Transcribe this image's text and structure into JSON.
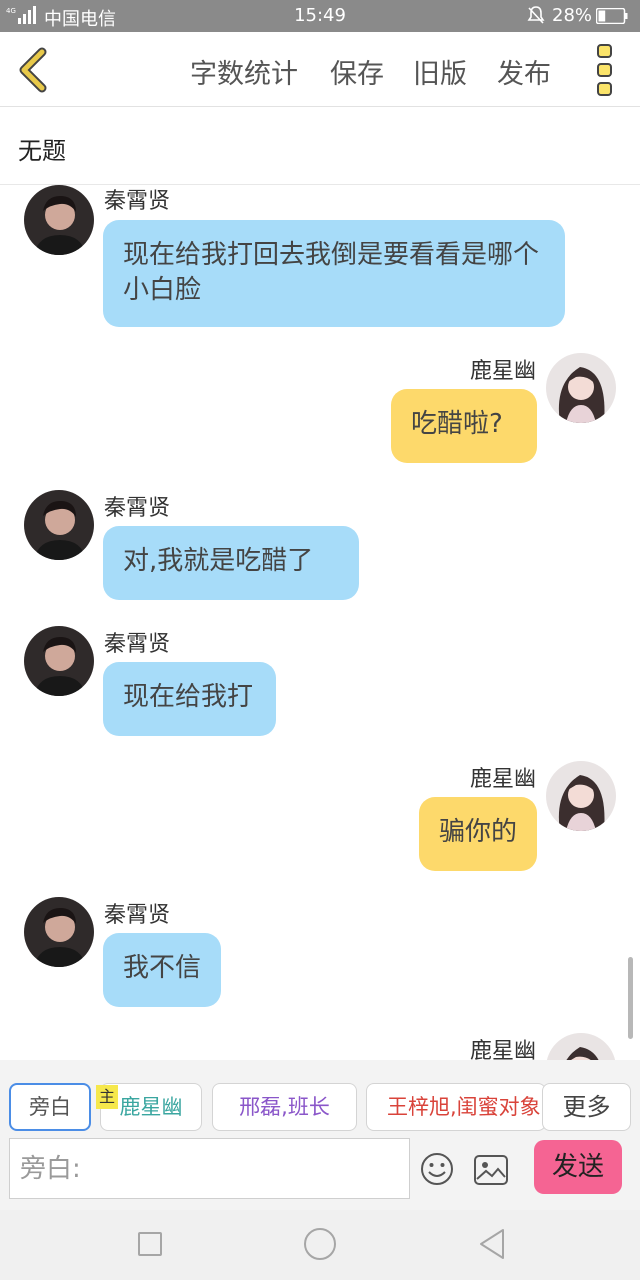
{
  "status_bar": {
    "network": "4G",
    "carrier": "中国电信",
    "time": "15:49",
    "battery": "28%",
    "battery_level": 0.28
  },
  "header": {
    "back_icon": "chevron-left-icon",
    "menu": [
      "字数统计",
      "保存",
      "旧版",
      "发布"
    ],
    "more_icon": "vertical-dots-icon",
    "accent_color": "#e8c94a"
  },
  "document": {
    "title": "无题"
  },
  "messages": [
    {
      "side": "left",
      "name": "秦霄贤",
      "text": "现在给我打回去我倒是要看看是哪个小白脸"
    },
    {
      "side": "right",
      "name": "鹿星幽",
      "text": "吃醋啦?"
    },
    {
      "side": "left",
      "name": "秦霄贤",
      "text": "对,我就是吃醋了"
    },
    {
      "side": "left",
      "name": "秦霄贤",
      "text": "现在给我打"
    },
    {
      "side": "right",
      "name": "鹿星幽",
      "text": "骗你的"
    },
    {
      "side": "left",
      "name": "秦霄贤",
      "text": "我不信"
    },
    {
      "side": "right",
      "name": "鹿星幽",
      "text": ""
    }
  ],
  "bubble_colors": {
    "left": "#a7dcf9",
    "right": "#fdd96b"
  },
  "composer": {
    "characters": [
      {
        "label": "旁白",
        "color": "#555555"
      },
      {
        "label": "鹿星幽",
        "color": "#3aa6a0",
        "tag": "主"
      },
      {
        "label": "邢磊,班长",
        "color": "#8a56c9"
      },
      {
        "label": "王梓旭,闺蜜对象",
        "color": "#d9433a"
      }
    ],
    "more_label": "更多",
    "placeholder": "旁白:",
    "emoji_icon": "smiley-icon",
    "image_icon": "image-icon",
    "send_label": "发送",
    "send_color": "#f56493"
  },
  "nav_bar": {
    "icons": [
      "recent-apps-icon",
      "home-icon",
      "back-icon"
    ]
  }
}
